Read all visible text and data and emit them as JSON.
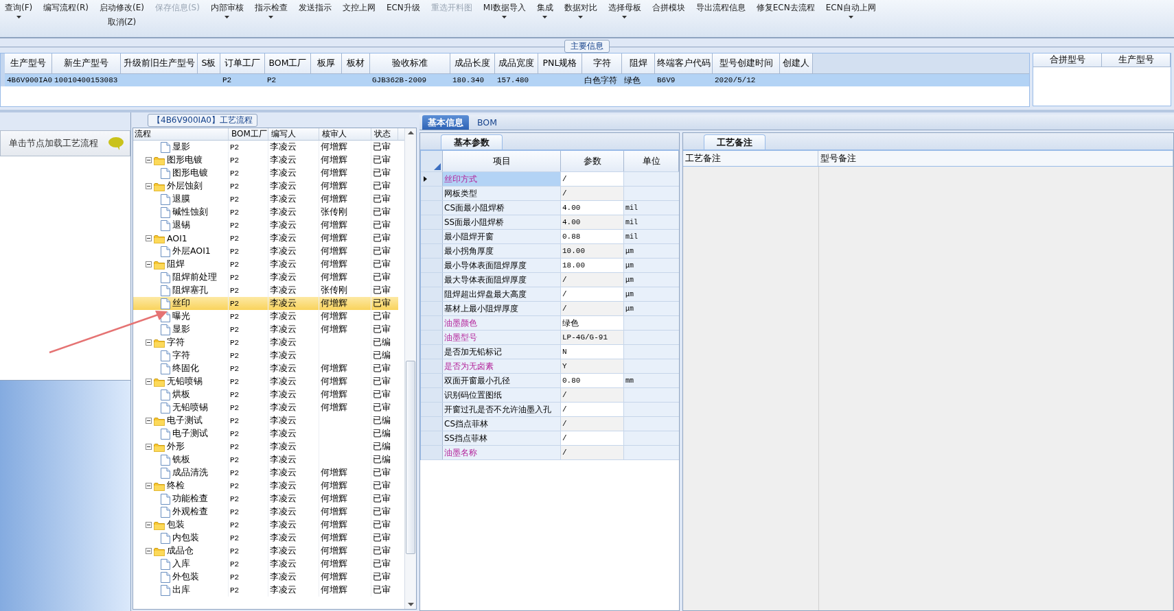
{
  "toolbar": {
    "groups": [
      [
        {
          "label": "查询(F)",
          "dropdown": true,
          "disabled": false
        }
      ],
      [
        {
          "label": "编写流程(R)",
          "dropdown": false,
          "disabled": false
        }
      ],
      [
        {
          "label": "启动修改(E)",
          "dropdown": false,
          "disabled": false
        },
        {
          "label": "取消(Z)",
          "dropdown": false,
          "disabled": false
        }
      ],
      [
        {
          "label": "保存信息(S)",
          "dropdown": false,
          "disabled": true
        }
      ],
      [
        {
          "label": "内部审核",
          "dropdown": true,
          "disabled": false
        }
      ],
      [
        {
          "label": "指示检查",
          "dropdown": true,
          "disabled": false
        }
      ],
      [
        {
          "label": "发送指示",
          "dropdown": false,
          "disabled": false
        }
      ],
      [
        {
          "label": "文控上网",
          "dropdown": false,
          "disabled": false
        }
      ],
      [
        {
          "label": "ECN升级",
          "dropdown": false,
          "disabled": false
        }
      ],
      [
        {
          "label": "重选开料图",
          "dropdown": false,
          "disabled": true
        }
      ],
      [
        {
          "label": "MI数据导入",
          "dropdown": true,
          "disabled": false
        }
      ],
      [
        {
          "label": "集成",
          "dropdown": true,
          "disabled": false
        }
      ],
      [
        {
          "label": "数据对比",
          "dropdown": true,
          "disabled": false
        }
      ],
      [
        {
          "label": "选择母板",
          "dropdown": true,
          "disabled": false
        }
      ],
      [
        {
          "label": "合拼模块",
          "dropdown": false,
          "disabled": false
        }
      ],
      [
        {
          "label": "导出流程信息",
          "dropdown": false,
          "disabled": false
        }
      ],
      [
        {
          "label": "修复ECN去流程",
          "dropdown": false,
          "disabled": false
        }
      ],
      [
        {
          "label": "ECN自动上网",
          "dropdown": true,
          "disabled": false
        }
      ]
    ]
  },
  "main_info": {
    "title": "主要信息",
    "columns": [
      "生产型号",
      "新生产型号",
      "升级前旧生产型号",
      "S板",
      "订单工厂",
      "BOM工厂",
      "板厚",
      "板材",
      "验收标准",
      "成品长度",
      "成品宽度",
      "PNL规格",
      "字符",
      "阻焊",
      "终端客户代码",
      "型号创建时间",
      "创建人"
    ],
    "rows": [
      {
        "selected": true,
        "cells": [
          "4B6V900IA0",
          "10010400153083",
          null,
          null,
          "P2",
          "P2",
          null,
          null,
          "GJB362B-2009",
          "180.340",
          "157.480",
          null,
          "白色字符",
          "绿色",
          "B6V9",
          "2020/5/12",
          null
        ]
      }
    ],
    "side_table": {
      "columns": [
        "合拼型号",
        "生产型号"
      ]
    }
  },
  "left_panel": {
    "header": "单击节点加载工艺流程"
  },
  "flow": {
    "title": "【4B6V900IA0】工艺流程",
    "columns": [
      "流程",
      "BOM工厂",
      "编写人",
      "核审人",
      "状态"
    ],
    "tree": [
      {
        "kind": "step",
        "name": "显影",
        "factory": "P2",
        "writer": "李凌云",
        "reviewer": "何增辉",
        "status": "已审",
        "selected": false
      },
      {
        "kind": "folder",
        "name": "图形电镀",
        "factory": "P2",
        "writer": "李凌云",
        "reviewer": "何增辉",
        "status": "已审",
        "selected": false,
        "expanded": true,
        "children": [
          {
            "kind": "step",
            "name": "图形电镀",
            "factory": "P2",
            "writer": "李凌云",
            "reviewer": "何增辉",
            "status": "已审",
            "selected": false
          }
        ]
      },
      {
        "kind": "folder",
        "name": "外层蚀刻",
        "factory": "P2",
        "writer": "李凌云",
        "reviewer": "何增辉",
        "status": "已审",
        "selected": false,
        "expanded": true,
        "children": [
          {
            "kind": "step",
            "name": "退膜",
            "factory": "P2",
            "writer": "李凌云",
            "reviewer": "何增辉",
            "status": "已审",
            "selected": false
          },
          {
            "kind": "step",
            "name": "碱性蚀刻",
            "factory": "P2",
            "writer": "李凌云",
            "reviewer": "张传刚",
            "status": "已审",
            "selected": false
          },
          {
            "kind": "step",
            "name": "退锡",
            "factory": "P2",
            "writer": "李凌云",
            "reviewer": "何增辉",
            "status": "已审",
            "selected": false
          }
        ]
      },
      {
        "kind": "folder",
        "name": "AOI1",
        "factory": "P2",
        "writer": "李凌云",
        "reviewer": "何增辉",
        "status": "已审",
        "selected": false,
        "expanded": true,
        "children": [
          {
            "kind": "step",
            "name": "外层AOI1",
            "factory": "P2",
            "writer": "李凌云",
            "reviewer": "何增辉",
            "status": "已审",
            "selected": false
          }
        ]
      },
      {
        "kind": "folder",
        "name": "阻焊",
        "factory": "P2",
        "writer": "李凌云",
        "reviewer": "何增辉",
        "status": "已审",
        "selected": false,
        "expanded": true,
        "children": [
          {
            "kind": "step",
            "name": "阻焊前处理",
            "factory": "P2",
            "writer": "李凌云",
            "reviewer": "何增辉",
            "status": "已审",
            "selected": false
          },
          {
            "kind": "step",
            "name": "阻焊塞孔",
            "factory": "P2",
            "writer": "李凌云",
            "reviewer": "张传刚",
            "status": "已审",
            "selected": false
          },
          {
            "kind": "step",
            "name": "丝印",
            "factory": "P2",
            "writer": "李凌云",
            "reviewer": "何增辉",
            "status": "已审",
            "selected": true
          },
          {
            "kind": "step",
            "name": "曝光",
            "factory": "P2",
            "writer": "李凌云",
            "reviewer": "何增辉",
            "status": "已审",
            "selected": false
          },
          {
            "kind": "step",
            "name": "显影",
            "factory": "P2",
            "writer": "李凌云",
            "reviewer": "何增辉",
            "status": "已审",
            "selected": false
          }
        ]
      },
      {
        "kind": "folder",
        "name": "字符",
        "factory": "P2",
        "writer": "李凌云",
        "status": "已编",
        "selected": false,
        "expanded": true,
        "children": [
          {
            "kind": "step",
            "name": "字符",
            "factory": "P2",
            "writer": "李凌云",
            "status": "已编",
            "selected": false
          },
          {
            "kind": "step",
            "name": "终固化",
            "factory": "P2",
            "writer": "李凌云",
            "reviewer": "何增辉",
            "status": "已审",
            "selected": false
          }
        ]
      },
      {
        "kind": "folder",
        "name": "无铅喷锡",
        "factory": "P2",
        "writer": "李凌云",
        "reviewer": "何增辉",
        "status": "已审",
        "selected": false,
        "expanded": true,
        "children": [
          {
            "kind": "step",
            "name": "烘板",
            "factory": "P2",
            "writer": "李凌云",
            "reviewer": "何增辉",
            "status": "已审",
            "selected": false
          },
          {
            "kind": "step",
            "name": "无铅喷锡",
            "factory": "P2",
            "writer": "李凌云",
            "reviewer": "何增辉",
            "status": "已审",
            "selected": false
          }
        ]
      },
      {
        "kind": "folder",
        "name": "电子测试",
        "factory": "P2",
        "writer": "李凌云",
        "status": "已编",
        "selected": false,
        "expanded": true,
        "children": [
          {
            "kind": "step",
            "name": "电子测试",
            "factory": "P2",
            "writer": "李凌云",
            "status": "已编",
            "selected": false
          }
        ]
      },
      {
        "kind": "folder",
        "name": "外形",
        "factory": "P2",
        "writer": "李凌云",
        "status": "已编",
        "selected": false,
        "expanded": true,
        "children": [
          {
            "kind": "step",
            "name": "铣板",
            "factory": "P2",
            "writer": "李凌云",
            "status": "已编",
            "selected": false
          },
          {
            "kind": "step",
            "name": "成品清洗",
            "factory": "P2",
            "writer": "李凌云",
            "reviewer": "何增辉",
            "status": "已审",
            "selected": false
          }
        ]
      },
      {
        "kind": "folder",
        "name": "终检",
        "factory": "P2",
        "writer": "李凌云",
        "reviewer": "何增辉",
        "status": "已审",
        "selected": false,
        "expanded": true,
        "children": [
          {
            "kind": "step",
            "name": "功能检查",
            "factory": "P2",
            "writer": "李凌云",
            "reviewer": "何增辉",
            "status": "已审",
            "selected": false
          },
          {
            "kind": "step",
            "name": "外观检查",
            "factory": "P2",
            "writer": "李凌云",
            "reviewer": "何增辉",
            "status": "已审",
            "selected": false
          }
        ]
      },
      {
        "kind": "folder",
        "name": "包装",
        "factory": "P2",
        "writer": "李凌云",
        "reviewer": "何增辉",
        "status": "已审",
        "selected": false,
        "expanded": true,
        "children": [
          {
            "kind": "step",
            "name": "内包装",
            "factory": "P2",
            "writer": "李凌云",
            "reviewer": "何增辉",
            "status": "已审",
            "selected": false
          }
        ]
      },
      {
        "kind": "folder",
        "name": "成品仓",
        "factory": "P2",
        "writer": "李凌云",
        "reviewer": "何增辉",
        "status": "已审",
        "selected": false,
        "expanded": true,
        "children": [
          {
            "kind": "step",
            "name": "入库",
            "factory": "P2",
            "writer": "李凌云",
            "reviewer": "何增辉",
            "status": "已审",
            "selected": false
          },
          {
            "kind": "step",
            "name": "外包装",
            "factory": "P2",
            "writer": "李凌云",
            "reviewer": "何增辉",
            "status": "已审",
            "selected": false
          },
          {
            "kind": "step",
            "name": "出库",
            "factory": "P2",
            "writer": "李凌云",
            "reviewer": "何增辉",
            "status": "已审",
            "selected": false
          }
        ]
      }
    ]
  },
  "detail_tabs": [
    {
      "label": "基本信息",
      "selected": true
    },
    {
      "label": "BOM",
      "selected": false
    }
  ],
  "params": {
    "tab": "基本参数",
    "columns": [
      "项目",
      "参数",
      "单位"
    ],
    "rows": [
      {
        "name": "丝印方式",
        "value": "/",
        "emphasized": true,
        "selected": true
      },
      {
        "name": "网板类型",
        "value": "/",
        "emphasized": false,
        "selected": false
      },
      {
        "name": "CS面最小阻焊桥",
        "value": "4.00",
        "unit": "mil",
        "emphasized": false,
        "selected": false
      },
      {
        "name": "SS面最小阻焊桥",
        "value": "4.00",
        "unit": "mil",
        "emphasized": false,
        "selected": false
      },
      {
        "name": "最小阻焊开窗",
        "value": "0.88",
        "unit": "mil",
        "emphasized": false,
        "selected": false
      },
      {
        "name": "最小拐角厚度",
        "value": "10.00",
        "unit": "μm",
        "emphasized": false,
        "selected": false
      },
      {
        "name": "最小导体表面阻焊厚度",
        "value": "18.00",
        "unit": "μm",
        "emphasized": false,
        "selected": false
      },
      {
        "name": "最大导体表面阻焊厚度",
        "value": "/",
        "unit": "μm",
        "emphasized": false,
        "selected": false
      },
      {
        "name": "阻焊超出焊盘最大高度",
        "value": "/",
        "unit": "μm",
        "emphasized": false,
        "selected": false
      },
      {
        "name": "基材上最小阻焊厚度",
        "value": "/",
        "unit": "μm",
        "emphasized": false,
        "selected": false
      },
      {
        "name": "油墨颜色",
        "value": "绿色",
        "emphasized": true,
        "selected": false
      },
      {
        "name": "油墨型号",
        "value": "LP-4G/G-91",
        "emphasized": true,
        "selected": false
      },
      {
        "name": "是否加无铅标记",
        "value": "N",
        "emphasized": false,
        "selected": false
      },
      {
        "name": "是否为无卤素",
        "value": "Y",
        "emphasized": true,
        "selected": false
      },
      {
        "name": "双面开窗最小孔径",
        "value": "0.80",
        "unit": "mm",
        "emphasized": false,
        "selected": false
      },
      {
        "name": "识别码位置图纸",
        "value": "/",
        "emphasized": false,
        "selected": false
      },
      {
        "name": "开窗过孔是否不允许油墨入孔",
        "value": "/",
        "emphasized": false,
        "selected": false
      },
      {
        "name": "CS挡点菲林",
        "value": "/",
        "emphasized": false,
        "selected": false
      },
      {
        "name": "SS挡点菲林",
        "value": "/",
        "emphasized": false,
        "selected": false
      },
      {
        "name": "油墨名称",
        "value": "/",
        "emphasized": true,
        "selected": false
      }
    ]
  },
  "remarks": {
    "tab": "工艺备注",
    "columns": [
      "工艺备注",
      "型号备注"
    ]
  }
}
